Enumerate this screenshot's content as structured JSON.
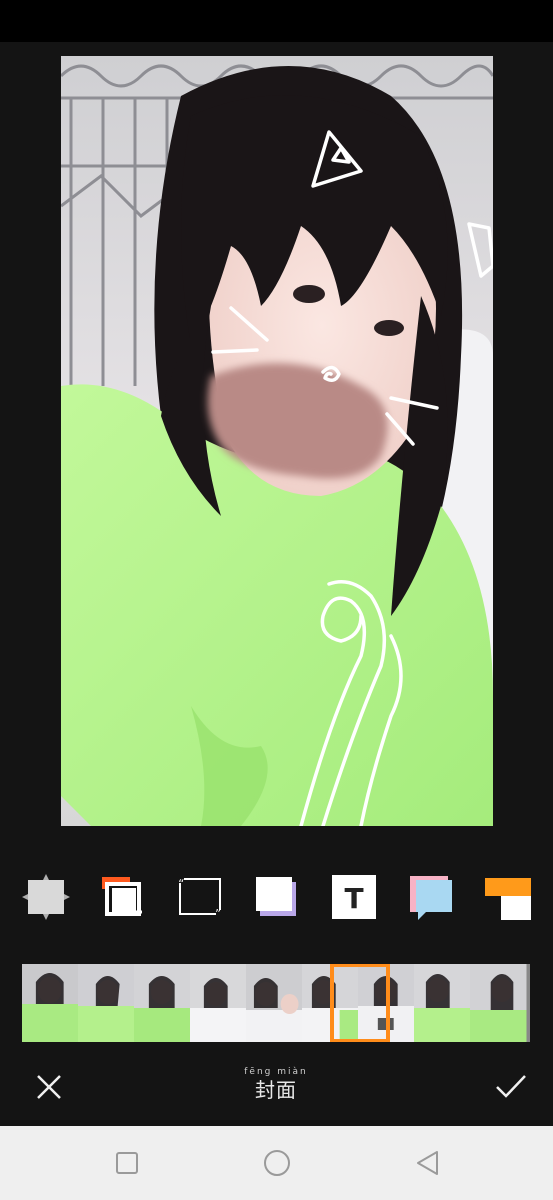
{
  "toolbar": {
    "title_pinyin": "fēng miàn",
    "title": "封面"
  },
  "templates": [
    {
      "name": "template-none",
      "accent": "#d9d9d9"
    },
    {
      "name": "template-offset-frame",
      "accent": "#ff5a1f"
    },
    {
      "name": "template-quote-frame",
      "accent": "#ffffff"
    },
    {
      "name": "template-stacked-card",
      "accent": "#b9a7e8"
    },
    {
      "name": "template-text",
      "accent": "#ffffff"
    },
    {
      "name": "template-speech-card",
      "accent": "#a9d8f2"
    },
    {
      "name": "template-orange-card",
      "accent": "#ff9a1a"
    }
  ],
  "filmstrip": {
    "frame_count": 9,
    "selected_index": 5,
    "selected_color": "#ff8c1a"
  },
  "colors": {
    "background": "#141414",
    "shirt": "#b6f58a",
    "blur_patch": "#b98a86",
    "navbar": "#efefef"
  }
}
